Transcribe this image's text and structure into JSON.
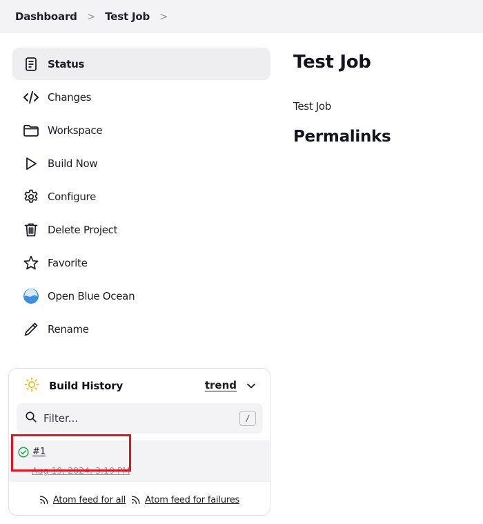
{
  "breadcrumb": {
    "items": [
      "Dashboard",
      "Test Job"
    ],
    "separator": ">"
  },
  "sidebar": {
    "tasks": [
      {
        "label": "Status",
        "icon": "status-document-icon",
        "active": true
      },
      {
        "label": "Changes",
        "icon": "code-icon"
      },
      {
        "label": "Workspace",
        "icon": "folder-icon"
      },
      {
        "label": "Build Now",
        "icon": "play-icon"
      },
      {
        "label": "Configure",
        "icon": "gear-icon"
      },
      {
        "label": "Delete Project",
        "icon": "trash-icon"
      },
      {
        "label": "Favorite",
        "icon": "star-icon"
      },
      {
        "label": "Open Blue Ocean",
        "icon": "blue-ocean-icon"
      },
      {
        "label": "Rename",
        "icon": "pencil-icon"
      }
    ]
  },
  "build_history": {
    "title": "Build History",
    "trend_label": "trend",
    "filter": {
      "placeholder": "Filter...",
      "shortcut": "/"
    },
    "builds": [
      {
        "number": "#1",
        "date": "Aug 19, 2024, 3:19 PM",
        "status": "success"
      }
    ],
    "feeds": {
      "all": "Atom feed for all",
      "failures": "Atom feed for failures"
    }
  },
  "main": {
    "title": "Test Job",
    "description": "Test Job",
    "permalinks_heading": "Permalinks"
  },
  "colors": {
    "success": "#1ea64b",
    "highlight": "#e3141c",
    "sun": "#f5b50a",
    "blue_ocean": "#3d8fe0"
  }
}
